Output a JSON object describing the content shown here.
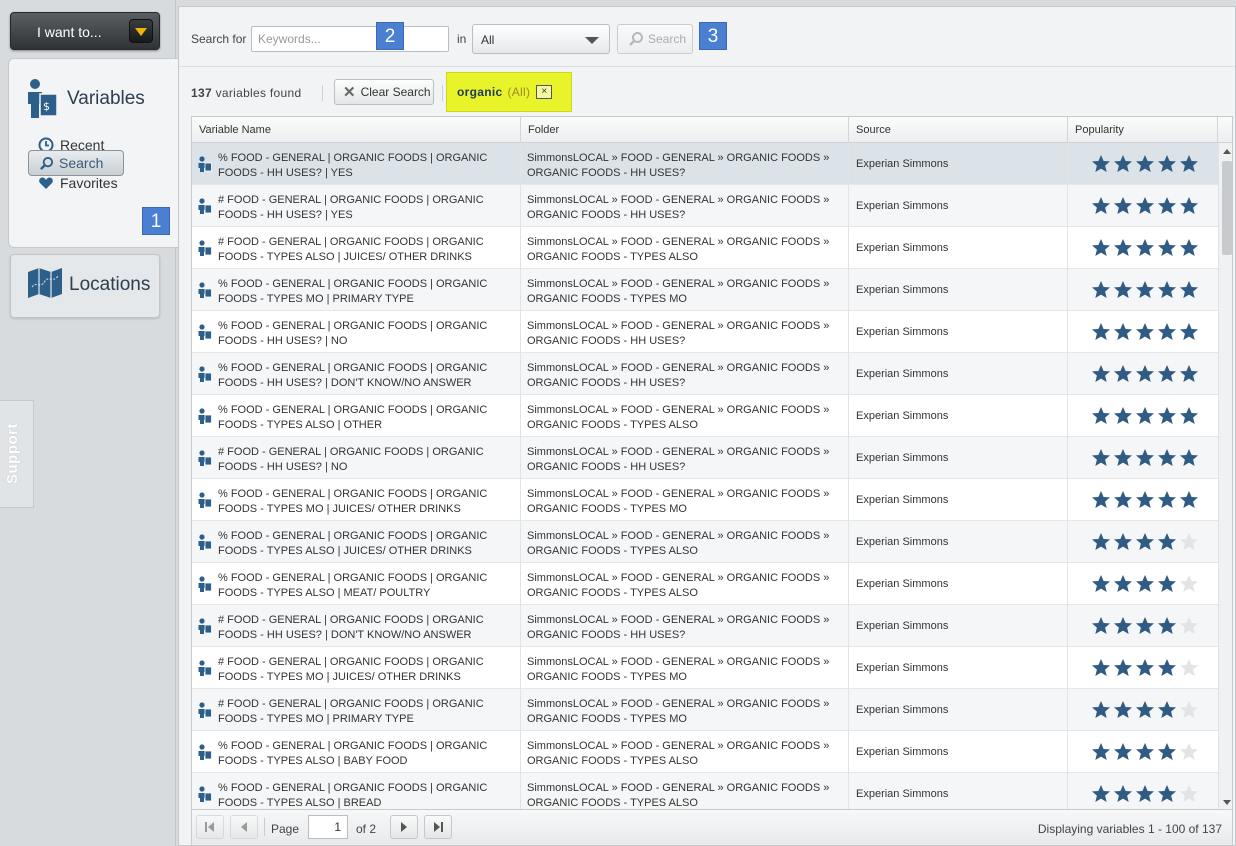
{
  "sidebar": {
    "menu_button_label": "I want to...",
    "variables_title": "Variables",
    "nav": [
      {
        "label": "Recent",
        "icon": "clock-icon"
      },
      {
        "label": "Favorites",
        "icon": "heart-icon"
      },
      {
        "label": "Search",
        "icon": "search-icon"
      }
    ],
    "locations_title": "Locations",
    "support_label": "Support"
  },
  "badges": [
    "1",
    "2",
    "3"
  ],
  "search": {
    "search_for_label": "Search for",
    "keyword_placeholder": "Keywords...",
    "keyword_value": "",
    "in_label": "in",
    "scope_value": "All",
    "search_button_label": "Search"
  },
  "results": {
    "count": "137",
    "count_suffix": "variables found",
    "clear_label": "Clear Search",
    "chip_keyword": "organic",
    "chip_scope": "(All)",
    "chip_close": "×"
  },
  "table": {
    "columns": [
      "Variable Name",
      "Folder",
      "Source",
      "Popularity"
    ],
    "rows": [
      {
        "name": "% FOOD - GENERAL | ORGANIC FOODS | ORGANIC FOODS - HH USES? | YES",
        "folder": "SimmonsLOCAL » FOOD - GENERAL » ORGANIC FOODS » ORGANIC FOODS - HH USES?",
        "source": "Experian Simmons",
        "stars": 5
      },
      {
        "name": "# FOOD - GENERAL | ORGANIC FOODS | ORGANIC FOODS - HH USES? | YES",
        "folder": "SimmonsLOCAL » FOOD - GENERAL » ORGANIC FOODS » ORGANIC FOODS - HH USES?",
        "source": "Experian Simmons",
        "stars": 5
      },
      {
        "name": "# FOOD - GENERAL | ORGANIC FOODS | ORGANIC FOODS - TYPES ALSO | JUICES/ OTHER DRINKS",
        "folder": "SimmonsLOCAL » FOOD - GENERAL » ORGANIC FOODS » ORGANIC FOODS - TYPES ALSO",
        "source": "Experian Simmons",
        "stars": 5
      },
      {
        "name": "% FOOD - GENERAL | ORGANIC FOODS | ORGANIC FOODS - TYPES MO | PRIMARY TYPE",
        "folder": "SimmonsLOCAL » FOOD - GENERAL » ORGANIC FOODS » ORGANIC FOODS - TYPES MO",
        "source": "Experian Simmons",
        "stars": 5
      },
      {
        "name": "% FOOD - GENERAL | ORGANIC FOODS | ORGANIC FOODS - HH USES? | NO",
        "folder": "SimmonsLOCAL » FOOD - GENERAL » ORGANIC FOODS » ORGANIC FOODS - HH USES?",
        "source": "Experian Simmons",
        "stars": 5
      },
      {
        "name": "% FOOD - GENERAL | ORGANIC FOODS | ORGANIC FOODS - HH USES? | DON'T KNOW/NO ANSWER",
        "folder": "SimmonsLOCAL » FOOD - GENERAL » ORGANIC FOODS » ORGANIC FOODS - HH USES?",
        "source": "Experian Simmons",
        "stars": 5
      },
      {
        "name": "% FOOD - GENERAL | ORGANIC FOODS | ORGANIC FOODS - TYPES ALSO | OTHER",
        "folder": "SimmonsLOCAL » FOOD - GENERAL » ORGANIC FOODS » ORGANIC FOODS - TYPES ALSO",
        "source": "Experian Simmons",
        "stars": 5
      },
      {
        "name": "# FOOD - GENERAL | ORGANIC FOODS | ORGANIC FOODS - HH USES? | NO",
        "folder": "SimmonsLOCAL » FOOD - GENERAL » ORGANIC FOODS » ORGANIC FOODS - HH USES?",
        "source": "Experian Simmons",
        "stars": 5
      },
      {
        "name": "% FOOD - GENERAL | ORGANIC FOODS | ORGANIC FOODS - TYPES MO | JUICES/ OTHER DRINKS",
        "folder": "SimmonsLOCAL » FOOD - GENERAL » ORGANIC FOODS » ORGANIC FOODS - TYPES MO",
        "source": "Experian Simmons",
        "stars": 5
      },
      {
        "name": "% FOOD - GENERAL | ORGANIC FOODS | ORGANIC FOODS - TYPES ALSO | JUICES/ OTHER DRINKS",
        "folder": "SimmonsLOCAL » FOOD - GENERAL » ORGANIC FOODS » ORGANIC FOODS - TYPES ALSO",
        "source": "Experian Simmons",
        "stars": 4
      },
      {
        "name": "% FOOD - GENERAL | ORGANIC FOODS | ORGANIC FOODS - TYPES ALSO | MEAT/ POULTRY",
        "folder": "SimmonsLOCAL » FOOD - GENERAL » ORGANIC FOODS » ORGANIC FOODS - TYPES ALSO",
        "source": "Experian Simmons",
        "stars": 4
      },
      {
        "name": "# FOOD - GENERAL | ORGANIC FOODS | ORGANIC FOODS - HH USES? | DON'T KNOW/NO ANSWER",
        "folder": "SimmonsLOCAL » FOOD - GENERAL » ORGANIC FOODS » ORGANIC FOODS - HH USES?",
        "source": "Experian Simmons",
        "stars": 4
      },
      {
        "name": "# FOOD - GENERAL | ORGANIC FOODS | ORGANIC FOODS - TYPES MO | JUICES/ OTHER DRINKS",
        "folder": "SimmonsLOCAL » FOOD - GENERAL » ORGANIC FOODS » ORGANIC FOODS - TYPES MO",
        "source": "Experian Simmons",
        "stars": 4
      },
      {
        "name": "# FOOD - GENERAL | ORGANIC FOODS | ORGANIC FOODS - TYPES MO | PRIMARY TYPE",
        "folder": "SimmonsLOCAL » FOOD - GENERAL » ORGANIC FOODS » ORGANIC FOODS - TYPES MO",
        "source": "Experian Simmons",
        "stars": 4
      },
      {
        "name": "% FOOD - GENERAL | ORGANIC FOODS | ORGANIC FOODS - TYPES ALSO | BABY FOOD",
        "folder": "SimmonsLOCAL » FOOD - GENERAL » ORGANIC FOODS » ORGANIC FOODS - TYPES ALSO",
        "source": "Experian Simmons",
        "stars": 4
      },
      {
        "name": "% FOOD - GENERAL | ORGANIC FOODS | ORGANIC FOODS - TYPES ALSO | BREAD",
        "folder": "SimmonsLOCAL » FOOD - GENERAL » ORGANIC FOODS » ORGANIC FOODS - TYPES ALSO",
        "source": "Experian Simmons",
        "stars": 4
      }
    ],
    "max_stars": 5
  },
  "pager": {
    "page_label": "Page",
    "page_value": "1",
    "of_label": "of 2",
    "display_text": "Displaying variables 1 - 100 of 137"
  },
  "colors": {
    "star_filled": "#2f5b84",
    "star_empty": "#e2e4e6",
    "chip_highlight": "#e9f32a",
    "badge": "#4a7fd2",
    "brand": "#2c5f8a"
  }
}
